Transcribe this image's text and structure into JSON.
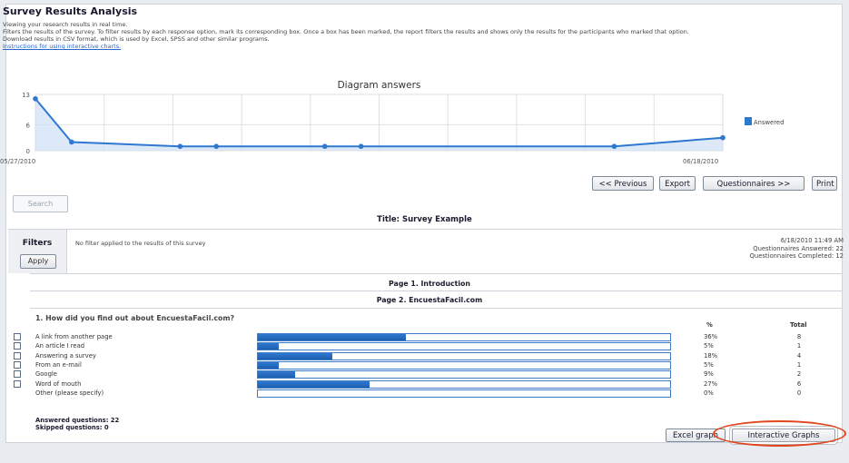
{
  "header": {
    "title": "Survey Results Analysis",
    "line1": "Viewing your research results in real time.",
    "line2": "Filters the results of the survey. To filter results by each response option, mark its corresponding box. Once a box has been marked, the report filters the results and shows only the results for the participants who marked that option.",
    "line3": "Download results in CSV format, which is used by Excel, SPSS and other similar programs.",
    "help_link": "Instructions for using interactive charts."
  },
  "chart_data": {
    "type": "line",
    "title": "Diagram answers",
    "x": [
      0,
      1,
      4,
      5,
      8,
      9,
      16,
      19
    ],
    "y_ticks": [
      0,
      6,
      13
    ],
    "ylim": [
      0,
      13
    ],
    "x_tick_labels": [
      "05/27/2010",
      "06/18/2010"
    ],
    "series": [
      {
        "name": "Answered",
        "values": [
          12,
          2,
          1,
          1,
          1,
          1,
          1,
          3
        ]
      }
    ],
    "legend_position": "right",
    "grid": true,
    "color": "#2f78d0"
  },
  "nav": {
    "previous": "<< Previous",
    "export": "Export",
    "questionnaires": "Questionnaires >>",
    "print": "Print"
  },
  "search_label": "Search",
  "survey_title": "Title: Survey Example",
  "filters": {
    "label": "Filters",
    "apply": "Apply",
    "status": "No filter applied to the results of this survey"
  },
  "stats": {
    "date": "6/18/2010 11:49 AM",
    "answered": "Questionnaires Answered: 22",
    "completed": "Questionnaires Completed: 12"
  },
  "pages": {
    "page1": "Page 1. Introduction",
    "page2": "Page 2. EncuestaFacil.com"
  },
  "question": {
    "text": "1. How did you find out about EncuestaFacil.com?",
    "col_pct": "%",
    "col_total": "Total",
    "options": [
      {
        "label": "A link from another page",
        "pct": "36%",
        "fraction": 0.36,
        "total": "8",
        "checkbox": true
      },
      {
        "label": "An article I read",
        "pct": "5%",
        "fraction": 0.05,
        "total": "1",
        "checkbox": true
      },
      {
        "label": "Answering a survey",
        "pct": "18%",
        "fraction": 0.18,
        "total": "4",
        "checkbox": true
      },
      {
        "label": "From an e-mail",
        "pct": "5%",
        "fraction": 0.05,
        "total": "1",
        "checkbox": true
      },
      {
        "label": "Google",
        "pct": "9%",
        "fraction": 0.09,
        "total": "2",
        "checkbox": true
      },
      {
        "label": "Word of mouth",
        "pct": "27%",
        "fraction": 0.27,
        "total": "6",
        "checkbox": true
      },
      {
        "label": "Other (please specify)",
        "pct": "0%",
        "fraction": 0.0,
        "total": "0",
        "checkbox": false
      }
    ],
    "answered": "Answered questions: 22",
    "skipped": "Skipped questions: 0"
  },
  "actions": {
    "excel_graph": "Excel graph",
    "interactive_graphs": "Interactive Graphs"
  },
  "colors": {
    "accent": "#2f78d0",
    "highlight": "#e2461e"
  }
}
